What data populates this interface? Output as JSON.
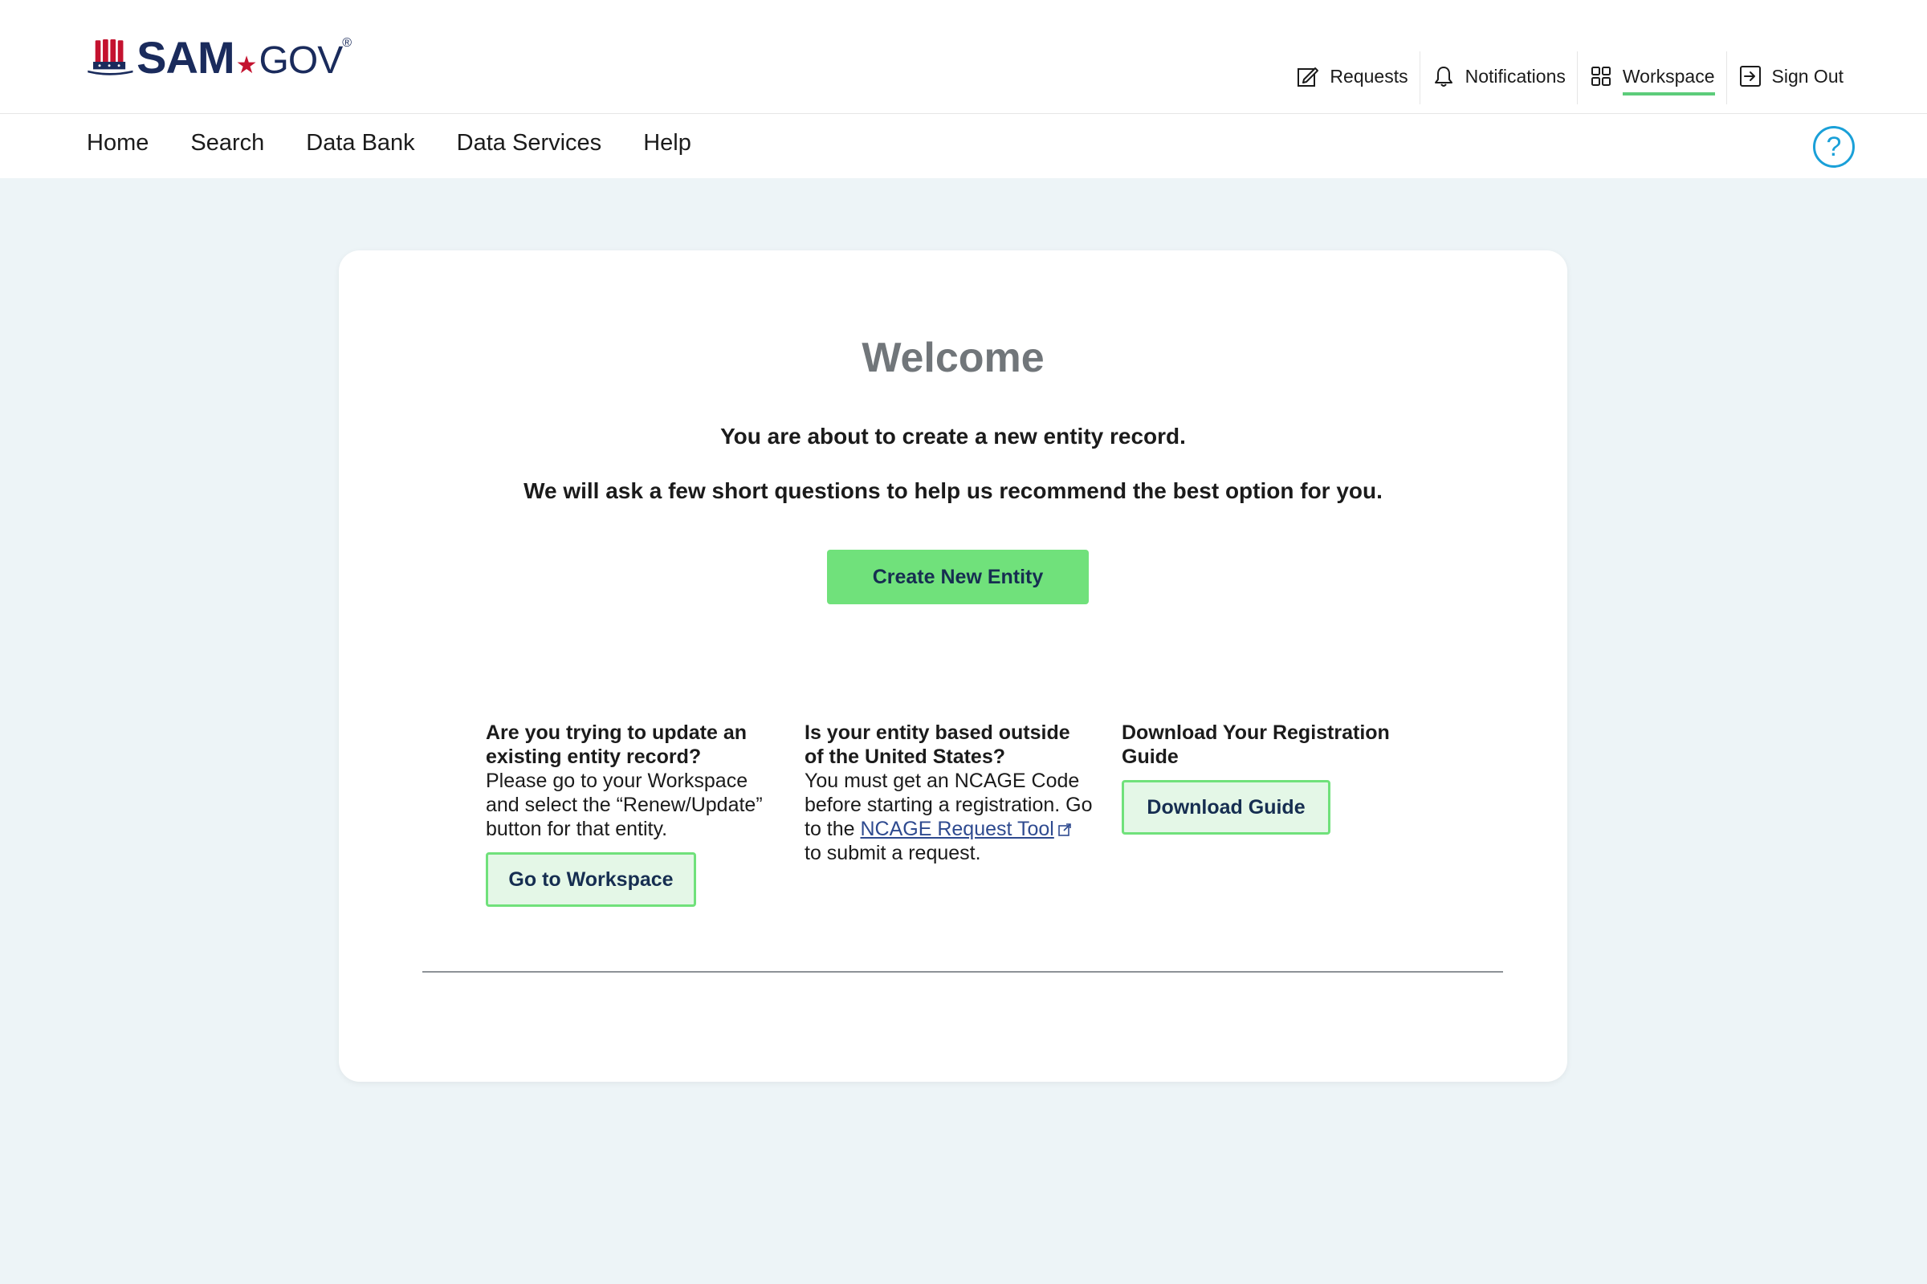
{
  "header": {
    "logo": {
      "sam": "SAM",
      "gov": "GOV",
      "reg": "®"
    },
    "utility": {
      "requests": "Requests",
      "notifications": "Notifications",
      "workspace": "Workspace",
      "sign_out": "Sign Out"
    },
    "nav": [
      "Home",
      "Search",
      "Data Bank",
      "Data Services",
      "Help"
    ],
    "help_glyph": "?"
  },
  "main": {
    "title": "Welcome",
    "lead1": "You are about to create a new entity record.",
    "lead2": "We will ask a few short questions to help us recommend the best option for you.",
    "create_button": "Create New Entity",
    "col1": {
      "title": "Are you trying to update an existing entity record?",
      "body": "Please go to your Workspace and select the “Renew/Update” button for that entity.",
      "button": "Go to Workspace"
    },
    "col2": {
      "title": "Is your entity based outside of the United States?",
      "body_pre": "You must get an NCAGE Code before starting a registration. Go to the ",
      "link": "NCAGE Request Tool",
      "body_post": " to submit a request."
    },
    "col3": {
      "title": "Download Your Registration Guide",
      "button": "Download Guide"
    }
  },
  "colors": {
    "accent_green": "#70e17b",
    "navy": "#162e51",
    "page_bg": "#edf4f7",
    "help_blue": "#1aa0d8",
    "brand_red": "#c4122f"
  },
  "icons": [
    "requests-icon",
    "bell-icon",
    "grid-icon",
    "sign-out-icon",
    "help-icon",
    "external-link-icon"
  ]
}
